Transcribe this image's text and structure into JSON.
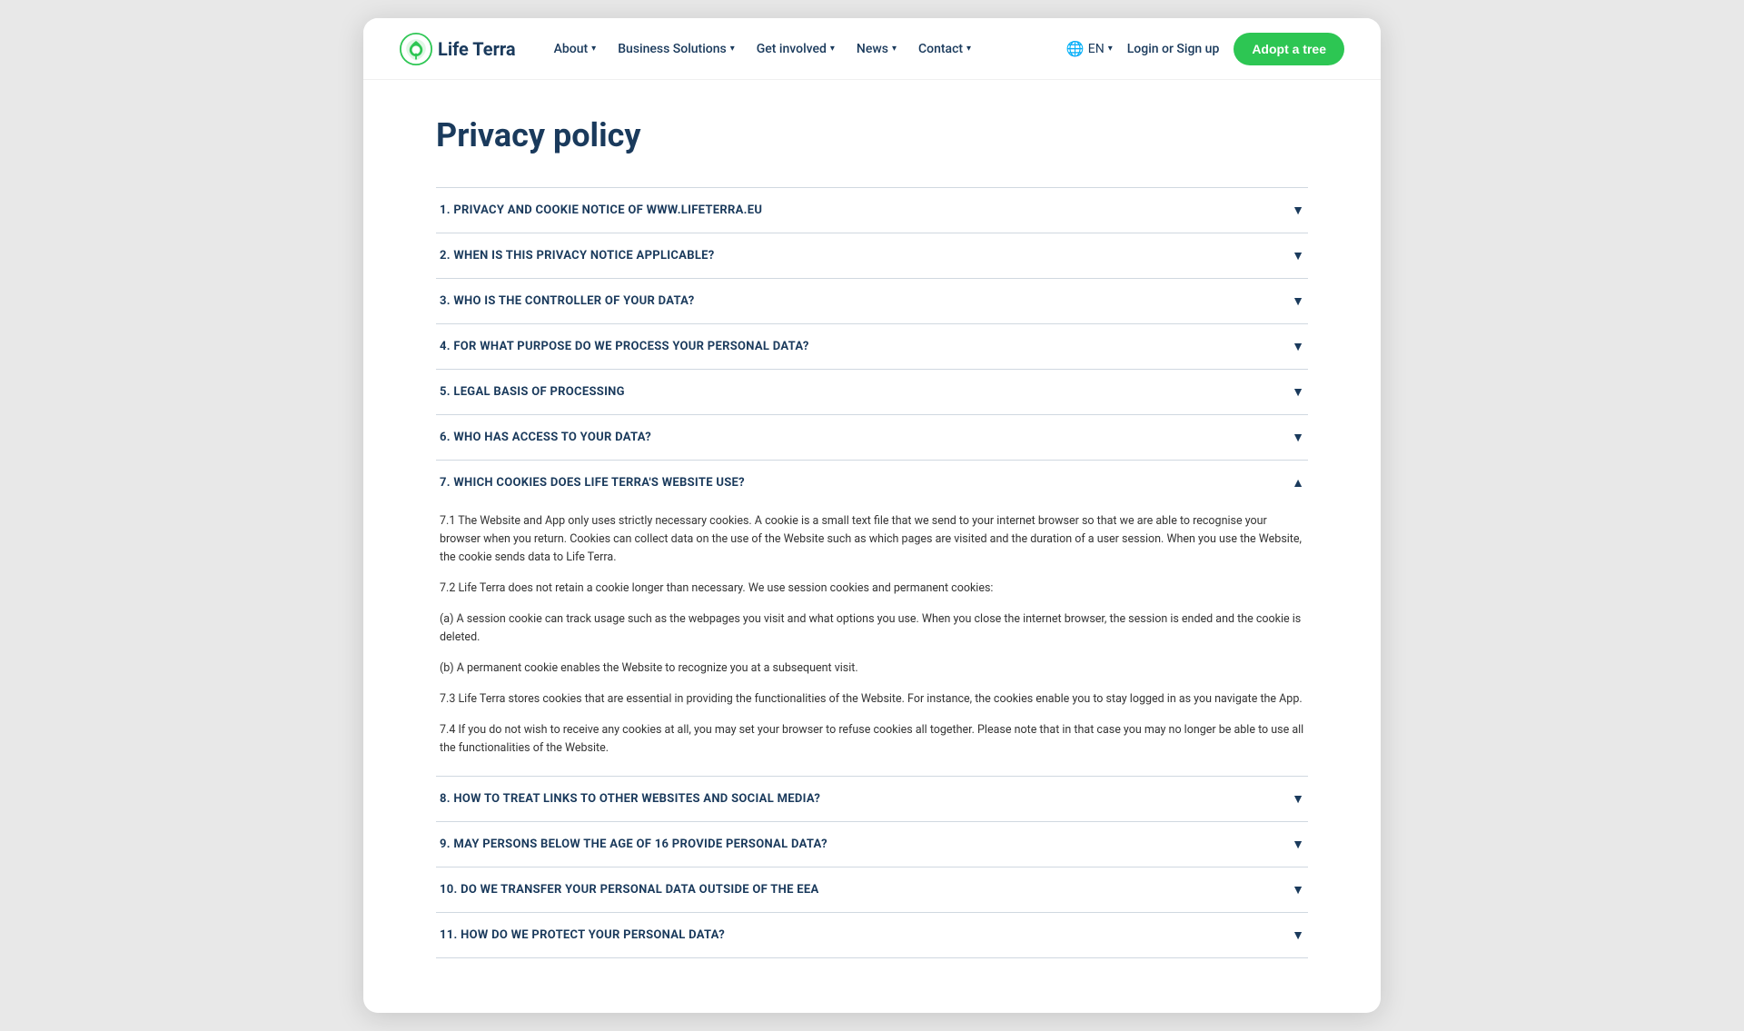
{
  "brand": {
    "name": "Life Terra"
  },
  "nav": {
    "items": [
      {
        "label": "About",
        "hasDropdown": true
      },
      {
        "label": "Business Solutions",
        "hasDropdown": true
      },
      {
        "label": "Get involved",
        "hasDropdown": true
      },
      {
        "label": "News",
        "hasDropdown": true
      },
      {
        "label": "Contact",
        "hasDropdown": true
      }
    ],
    "lang": "EN",
    "login": "Login or Sign up",
    "adopt_btn": "Adopt a tree"
  },
  "page": {
    "title": "Privacy policy"
  },
  "accordion": [
    {
      "id": 1,
      "heading": "1. PRIVACY AND COOKIE NOTICE OF www.lifeterra.eu",
      "open": false,
      "content": []
    },
    {
      "id": 2,
      "heading": "2. WHEN IS THIS PRIVACY NOTICE APPLICABLE?",
      "open": false,
      "content": []
    },
    {
      "id": 3,
      "heading": "3. WHO IS THE CONTROLLER OF YOUR DATA?",
      "open": false,
      "content": []
    },
    {
      "id": 4,
      "heading": "4. FOR WHAT PURPOSE DO WE PROCESS YOUR PERSONAL DATA?",
      "open": false,
      "content": []
    },
    {
      "id": 5,
      "heading": "5. LEGAL BASIS OF PROCESSING",
      "open": false,
      "content": []
    },
    {
      "id": 6,
      "heading": "6. WHO HAS ACCESS TO YOUR DATA?",
      "open": false,
      "content": []
    },
    {
      "id": 7,
      "heading": "7. WHICH COOKIES DOES LIFE TERRA'S WEBSITE USE?",
      "open": true,
      "content": [
        "7.1 The Website and App only uses strictly necessary cookies. A cookie is a small text file that we send to your internet browser so that we are able to recognise your browser when you return. Cookies can collect data on the use of the Website such as which pages are visited and the duration of a user session. When you use the Website, the cookie sends data to Life Terra.",
        "7.2 Life Terra does not retain a cookie longer than necessary. We use session cookies and permanent cookies:",
        "(a) A session cookie can track usage such as the webpages you visit and what options you use. When you close the internet browser, the session is ended and the cookie is deleted.",
        "(b) A permanent cookie enables the Website to recognize you at a subsequent visit.",
        "7.3 Life Terra stores cookies that are essential in providing the functionalities of the Website. For instance, the cookies enable you to stay logged in as you navigate the App.",
        "7.4 If you do not wish to receive any cookies at all, you may set your browser to refuse cookies all together. Please note that in that case you may no longer be able to use all the functionalities of the Website."
      ]
    },
    {
      "id": 8,
      "heading": "8. HOW TO TREAT LINKS TO OTHER WEBSITES AND SOCIAL MEDIA?",
      "open": false,
      "content": []
    },
    {
      "id": 9,
      "heading": "9. MAY PERSONS BELOW THE AGE OF 16 PROVIDE PERSONAL DATA?",
      "open": false,
      "content": []
    },
    {
      "id": 10,
      "heading": "10. DO WE TRANSFER YOUR PERSONAL DATA OUTSIDE OF THE EEA",
      "open": false,
      "content": []
    },
    {
      "id": 11,
      "heading": "11. HOW DO WE PROTECT YOUR PERSONAL DATA?",
      "open": false,
      "content": []
    }
  ]
}
